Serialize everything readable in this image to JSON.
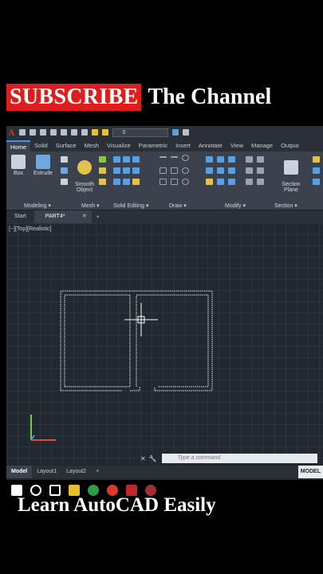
{
  "banner": {
    "subscribe": "SUBSCRIBE",
    "rest": "The Channel",
    "bottom": "Learn AutoCAD Easily"
  },
  "qat": {
    "logo": "A",
    "layer": "0"
  },
  "ribbon_tabs": [
    "Home",
    "Solid",
    "Surface",
    "Mesh",
    "Visualize",
    "Parametric",
    "Insert",
    "Annotate",
    "View",
    "Manage",
    "Output"
  ],
  "ribbon": {
    "box": "Box",
    "extrude": "Extrude",
    "smooth": "Smooth\nObject",
    "section": "Section\nPlane",
    "panels": [
      "Modeling ▾",
      "Mesh ▾",
      "Solid Editing ▾",
      "Draw ▾",
      "Modify ▾",
      "Section ▾"
    ]
  },
  "doc_tabs": {
    "start": "Start",
    "current": "PART4*",
    "close": "✕",
    "new": "+"
  },
  "viewport_label": "[−][Top][Realistic]",
  "command": {
    "placeholder": "Type a command"
  },
  "layout_tabs": [
    "Model",
    "Layout1",
    "Layout2",
    "+"
  ],
  "status_mode": "MODEL",
  "colors": {
    "accent": "#4b8ce8",
    "subscribe": "#e01d1d",
    "canvas": "#212830"
  }
}
